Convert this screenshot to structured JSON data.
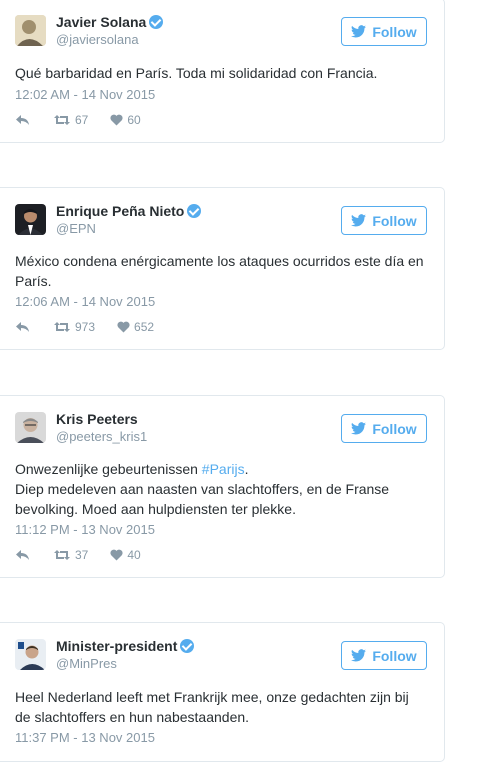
{
  "follow_label": "Follow",
  "colors": {
    "accent": "#55acee",
    "muted": "#8899a6",
    "text": "#292f33",
    "border": "#e1e8ed"
  },
  "tweets": [
    {
      "name": "Javier Solana",
      "handle": "@javiersolana",
      "verified": true,
      "text": "Qué barbaridad en París. Toda mi solidaridad con Francia.",
      "time": "12:02 AM - 14 Nov 2015",
      "retweets": "67",
      "likes": "60",
      "avatar_icon": "person-avatar-icon"
    },
    {
      "name": "Enrique Peña Nieto",
      "handle": "@EPN",
      "verified": true,
      "text": "México condena enérgicamente los ataques ocurridos este día en París.",
      "time": "12:06 AM - 14 Nov 2015",
      "retweets": "973",
      "likes": "652",
      "avatar_icon": "person-avatar-icon"
    },
    {
      "name": "Kris Peeters",
      "handle": "@peeters_kris1",
      "verified": false,
      "text_line1_pre": "Onwezenlijke gebeurtenissen ",
      "text_line1_hashtag": "#Parijs",
      "text_line1_post": ".",
      "text_rest": "Diep medeleven aan naasten van slachtoffers, en de Franse bevolking. Moed aan hulpdiensten ter plekke.",
      "time": "11:12 PM - 13 Nov 2015",
      "retweets": "37",
      "likes": "40",
      "avatar_icon": "person-avatar-icon"
    },
    {
      "name": "Minister-president",
      "handle": "@MinPres",
      "verified": true,
      "text": "Heel Nederland leeft met Frankrijk mee, onze gedachten zijn bij de slachtoffers en hun nabestaanden.",
      "time": "11:37 PM - 13 Nov 2015",
      "avatar_icon": "person-avatar-icon"
    }
  ]
}
